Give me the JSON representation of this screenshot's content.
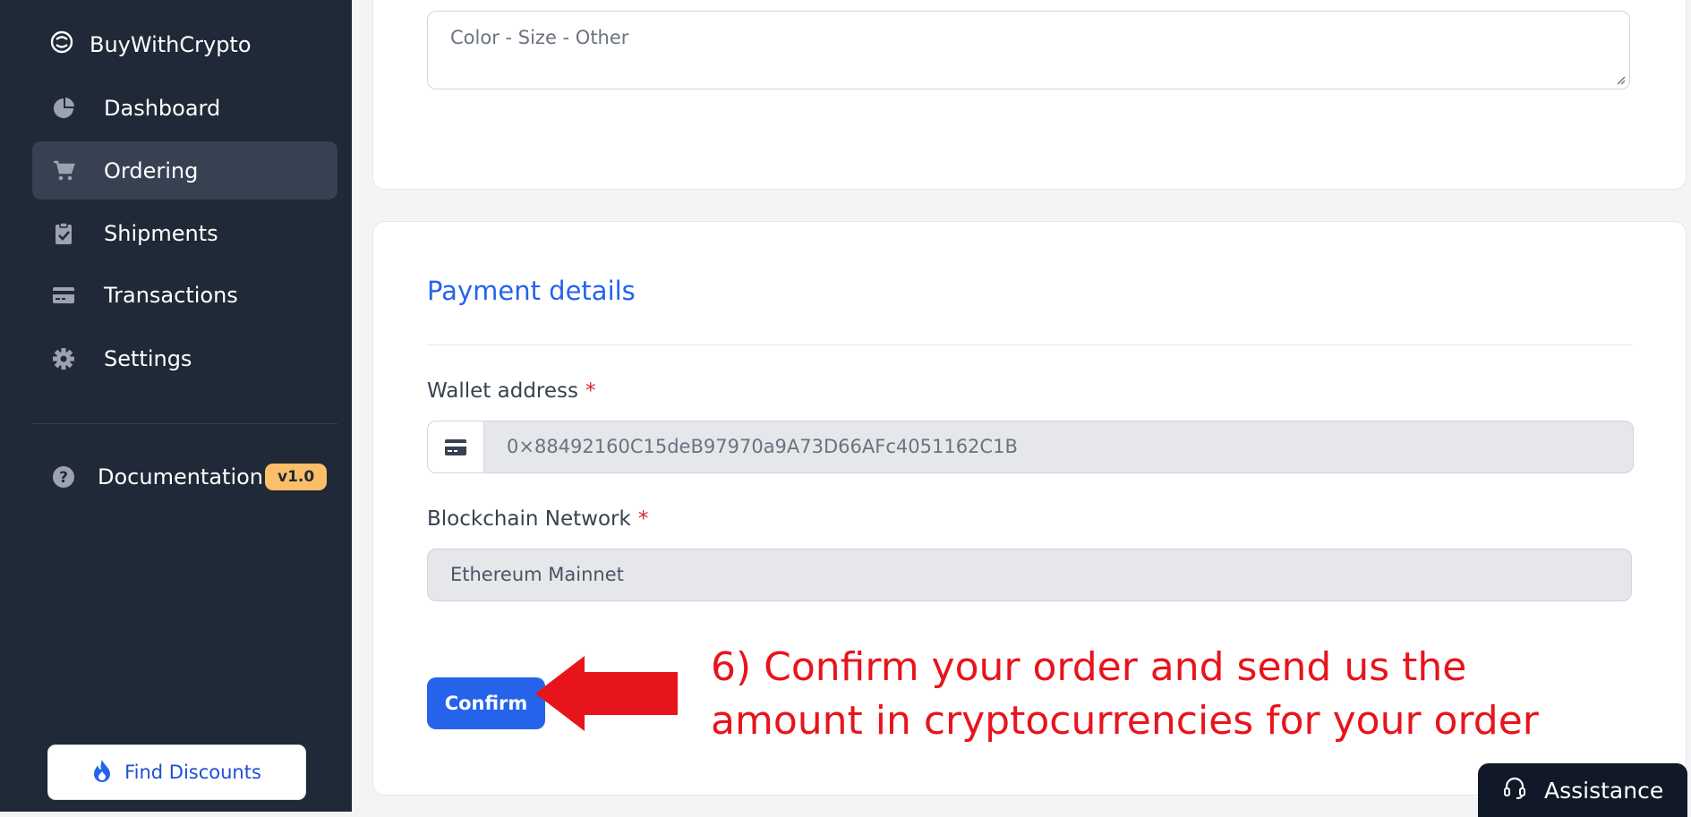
{
  "app": {
    "brand": "BuyWithCrypto"
  },
  "sidebar": {
    "items": [
      {
        "label": "Dashboard",
        "icon": "pie-chart-icon"
      },
      {
        "label": "Ordering",
        "icon": "cart-icon"
      },
      {
        "label": "Shipments",
        "icon": "clipboard-check-icon"
      },
      {
        "label": "Transactions",
        "icon": "credit-card-icon"
      },
      {
        "label": "Settings",
        "icon": "gear-icon"
      }
    ],
    "active_item": "Ordering",
    "documentation": {
      "label": "Documentation",
      "badge": "v1.0",
      "icon": "question-icon"
    },
    "find_discounts": {
      "label": "Find Discounts",
      "icon": "flame-icon"
    }
  },
  "form": {
    "options_placeholder": "Color - Size - Other",
    "payment_title": "Payment details",
    "wallet": {
      "label": "Wallet address",
      "required": "*",
      "value": "0×88492160C15deB97970a9A73D66AFc4051162C1B"
    },
    "network": {
      "label": "Blockchain Network",
      "required": "*",
      "value": "Ethereum Mainnet"
    },
    "confirm_label": "Confirm"
  },
  "annotation": {
    "line1": "6) Confirm your order and send us the",
    "line2": "amount in cryptocurrencies for your order",
    "color": "#e8141c"
  },
  "assistance": {
    "label": "Assistance",
    "icon": "headset-icon"
  },
  "colors": {
    "sidebar": "#1f2937",
    "accent": "#2563eb",
    "badge": "#fbbf6a"
  }
}
